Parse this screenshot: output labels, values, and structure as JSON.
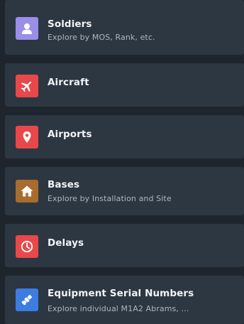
{
  "menu": {
    "items": [
      {
        "id": "soldiers",
        "title": "Soldiers",
        "subtitle": "Explore by MOS, Rank, etc.",
        "icon": "person-icon",
        "icon_color": "#9b8ee8"
      },
      {
        "id": "aircraft",
        "title": "Aircraft",
        "subtitle": "",
        "icon": "airplane-icon",
        "icon_color": "#e8484a"
      },
      {
        "id": "airports",
        "title": "Airports",
        "subtitle": "",
        "icon": "location-pin-icon",
        "icon_color": "#e8484a"
      },
      {
        "id": "bases",
        "title": "Bases",
        "subtitle": "Explore by Installation and Site",
        "icon": "home-icon",
        "icon_color": "#a86d2e"
      },
      {
        "id": "delays",
        "title": "Delays",
        "subtitle": "",
        "icon": "clock-icon",
        "icon_color": "#e8484a"
      },
      {
        "id": "equipment-serial-numbers",
        "title": "Equipment Serial Numbers",
        "subtitle": "Explore individual M1A2 Abrams, ...",
        "icon": "satellite-icon",
        "icon_color": "#3d7ce0"
      }
    ]
  }
}
